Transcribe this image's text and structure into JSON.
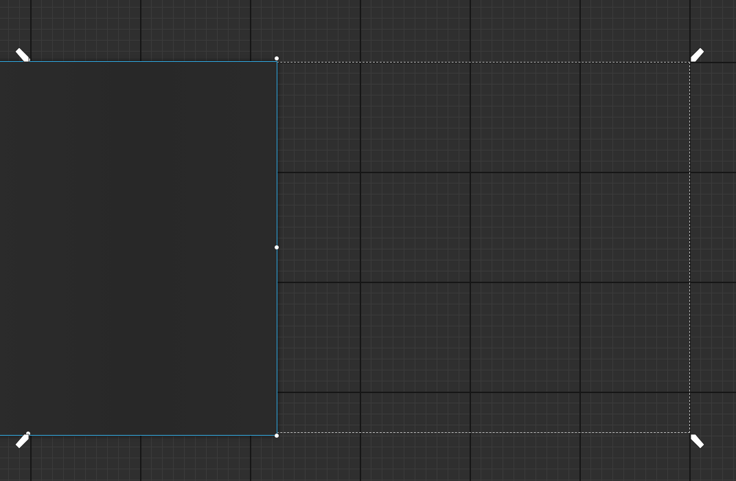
{
  "editor": {
    "grid_minor_color": "#3b3b3b",
    "grid_major_color": "#161616",
    "background_color": "#2f2f2f",
    "selection_color": "#2fa8e0",
    "dashed_outline_color": "#bdbdbd"
  },
  "icons": {
    "anchor_top_left": "anchor-top-left-icon",
    "anchor_top_right": "anchor-top-right-icon",
    "anchor_bottom_left": "anchor-bottom-left-icon",
    "anchor_bottom_right": "anchor-bottom-right-icon"
  }
}
